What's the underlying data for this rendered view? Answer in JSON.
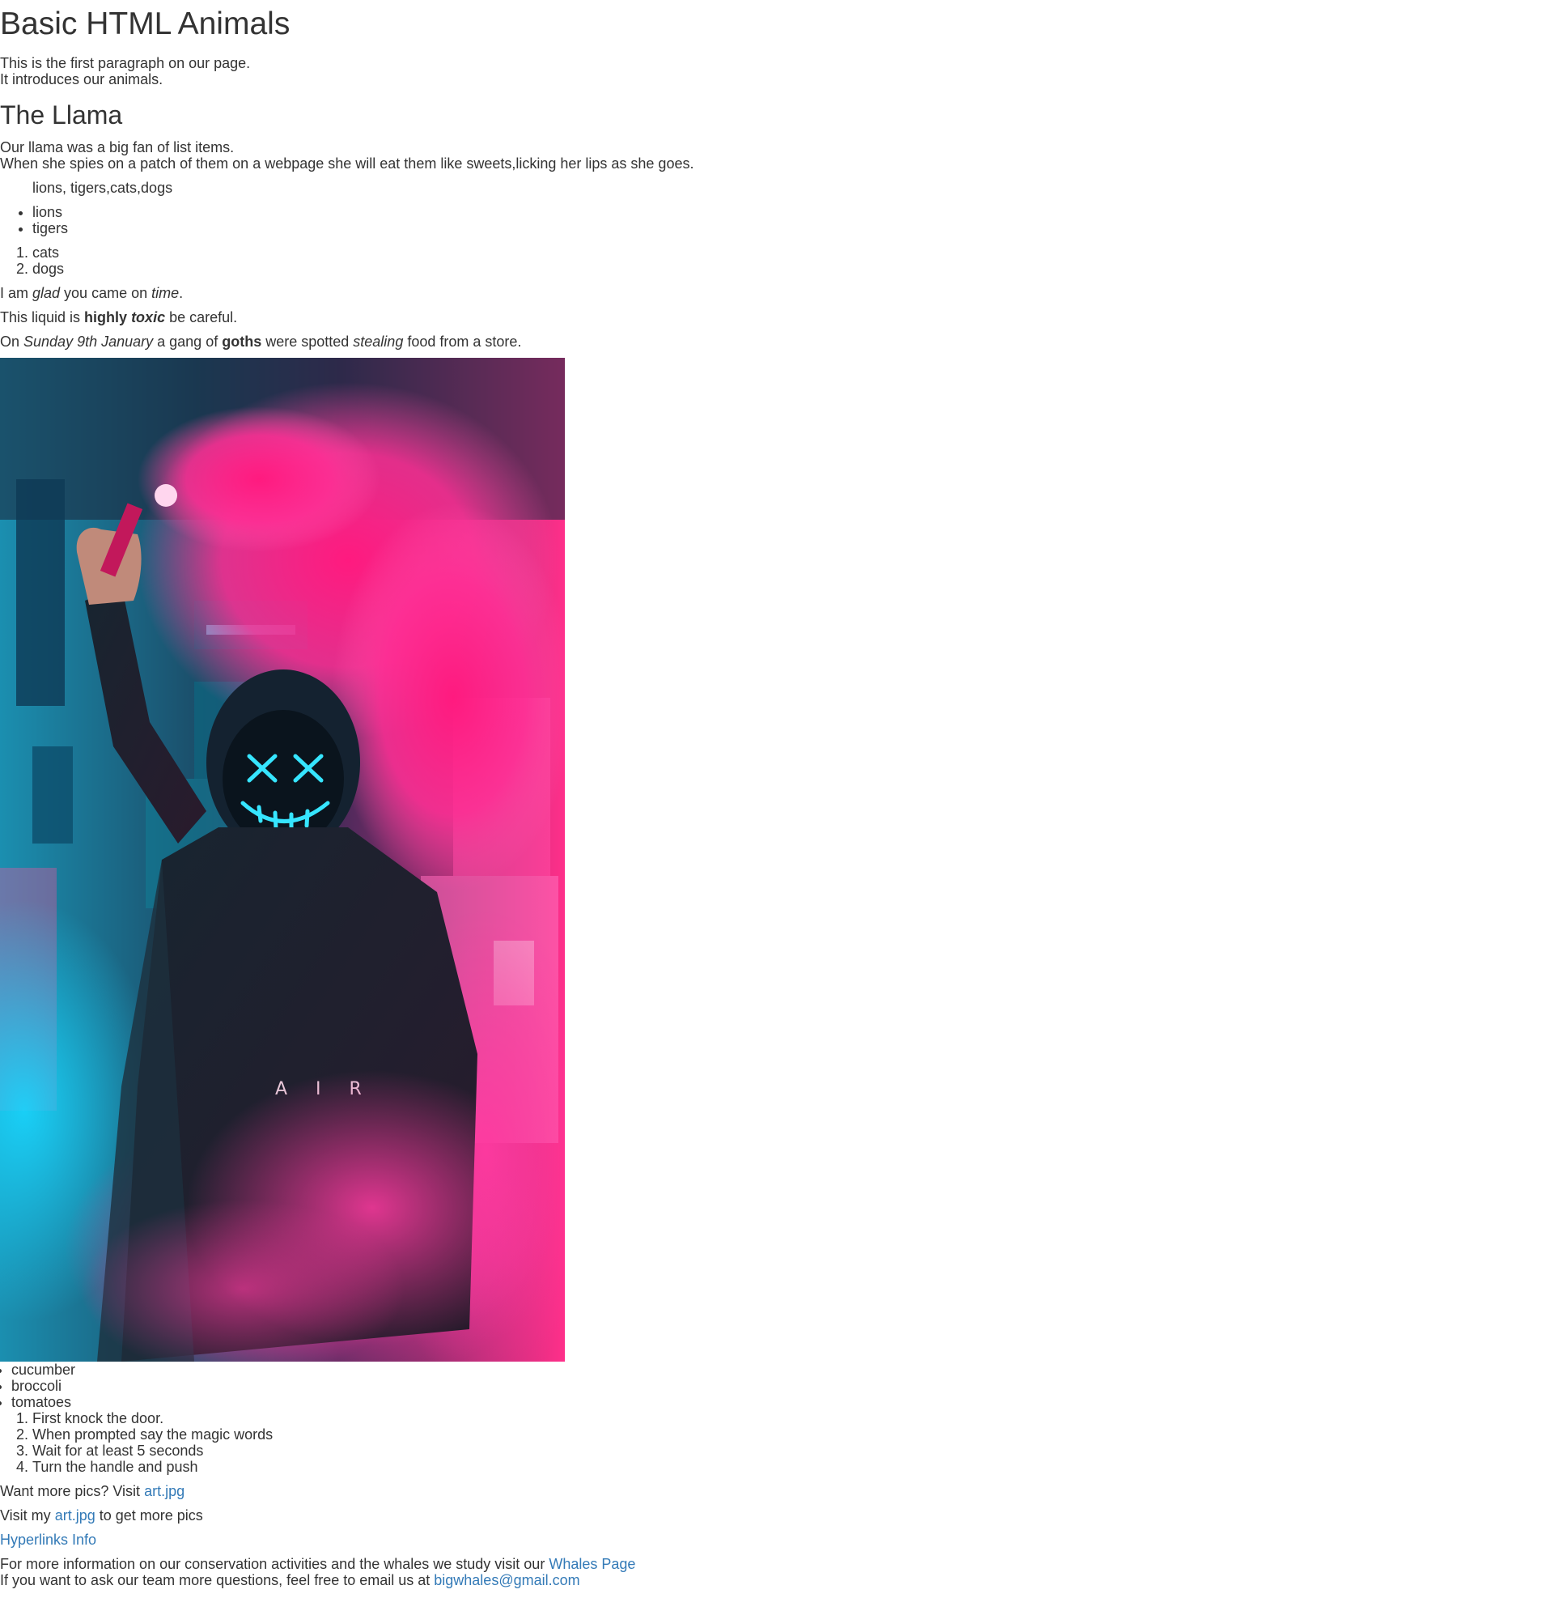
{
  "title": "Basic HTML Animals",
  "intro": {
    "line1": "This is the first paragraph on our page.",
    "line2": "It introduces our animals."
  },
  "llama": {
    "heading": "The Llama",
    "line1": "Our llama was a big fan of list items.",
    "line2": "When she spies on a patch of them on a webpage she will eat them like sweets,licking her lips as she goes.",
    "quote": "lions, tigers,cats,dogs",
    "bullets": [
      "lions",
      "tigers"
    ],
    "numbered": [
      "cats",
      "dogs"
    ]
  },
  "glad": {
    "p1": "I am ",
    "glad": "glad",
    "p2": " you came on ",
    "time": "time",
    "p3": "."
  },
  "toxic": {
    "p1": "This liquid is ",
    "highly": "highly",
    "toxic": "toxic",
    "p2": " be careful."
  },
  "goths": {
    "p1": "On ",
    "date": "Sunday 9th January",
    "p2": " a gang of ",
    "goths": "goths",
    "p3": " were spotted ",
    "stealing": "stealing",
    "p4": " food from a store."
  },
  "image": {
    "shirt_text": "A I R"
  },
  "veg": [
    "cucumber",
    "broccoli",
    "tomatoes"
  ],
  "steps": [
    "First knock the door.",
    "When prompted say the magic words",
    "Wait for at least 5 seconds",
    "Turn the handle and push"
  ],
  "morepics": {
    "p1": "Want more pics? Visit ",
    "link": "art.jpg"
  },
  "visitmy": {
    "p1": "Visit my ",
    "link": "art.jpg",
    "p2": " to get more pics"
  },
  "hyperlinks": "Hyperlinks Info",
  "conservation": {
    "p1": "For more information on our conservation activities and the whales we study visit our ",
    "link": "Whales Page",
    "p2": "If you want to ask our team more questions, feel free to email us at ",
    "email": "bigwhales@gmail.com"
  },
  "colors": {
    "link": "#337ab7",
    "text": "#333333"
  }
}
